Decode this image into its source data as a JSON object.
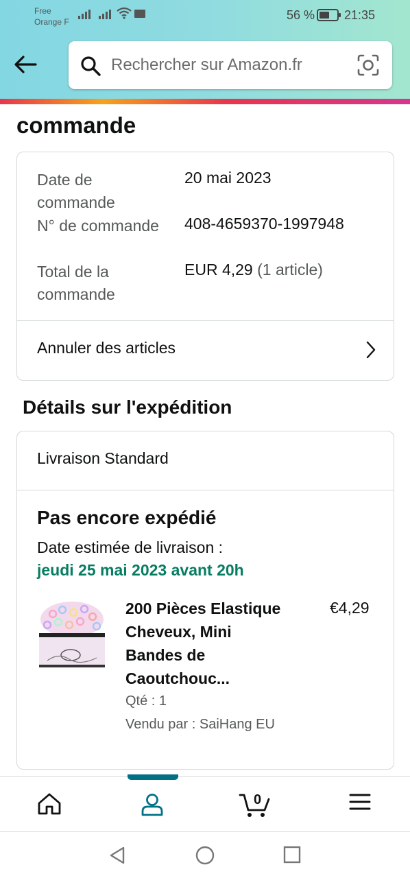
{
  "status_bar": {
    "carrier_line1": "Free",
    "carrier_line2": "Orange F",
    "battery": "56 %",
    "time": "21:35"
  },
  "header": {
    "search_placeholder": "Rechercher sur Amazon.fr"
  },
  "page": {
    "title": "commande"
  },
  "order_summary": {
    "date_label": "Date de commande",
    "date_value": "20 mai 2023",
    "number_label": "N° de commande",
    "number_value": "408-4659370-1997948",
    "total_label": "Total de la commande",
    "total_value": "EUR 4,29",
    "total_items": "(1 article)",
    "cancel_label": "Annuler des articles"
  },
  "shipping": {
    "section_title": "Détails sur l'expédition",
    "method": "Livraison Standard",
    "status": "Pas encore expédié",
    "eta_label": "Date estimée de livraison :",
    "eta_date": "jeudi 25 mai 2023 avant 20h",
    "item": {
      "title": "200 Pièces Elastique Cheveux, Mini Bandes de Caoutchouc...",
      "price": "€4,29",
      "qty": "Qté : 1",
      "seller": "Vendu par : SaiHang EU"
    }
  },
  "bottom_nav": {
    "cart_count": "0",
    "items": [
      "home-icon",
      "account-icon",
      "cart-icon",
      "menu-icon"
    ]
  },
  "colors": {
    "accent_teal": "#007185",
    "eta_green": "#067d62"
  }
}
